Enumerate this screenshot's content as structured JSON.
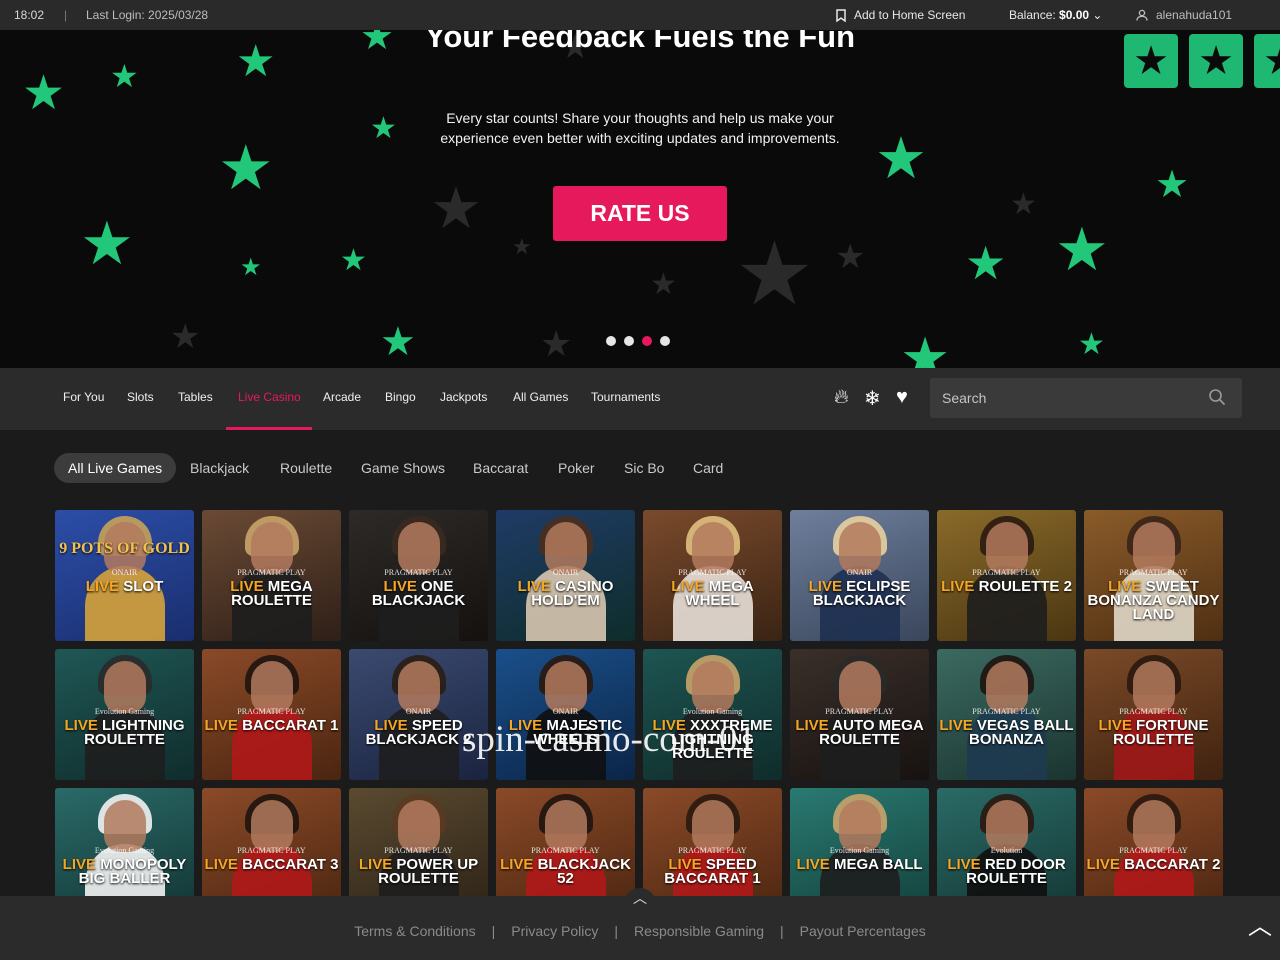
{
  "topbar": {
    "time": "18:02",
    "separator": "|",
    "last_login": "Last Login: 2025/03/28",
    "add_home": "Add to Home Screen",
    "balance_label": "Balance:",
    "balance_value": "$0.00",
    "username": "alenahuda101"
  },
  "hero": {
    "title": "Your Feedback Fuels the Fun",
    "text": "Every star counts! Share your thoughts and help us make your experience even better with exciting updates and improvements.",
    "button": "RATE US",
    "slides": 4,
    "active_slide": 3,
    "accent": "#e5195b",
    "star_color": "#22c77a"
  },
  "nav": {
    "items": [
      "For You",
      "Slots",
      "Tables",
      "Live Casino",
      "Arcade",
      "Bingo",
      "Jackpots",
      "All Games",
      "Tournaments"
    ],
    "active": "Live Casino",
    "icons": [
      "fire-icon",
      "snowflake-icon",
      "heart-icon"
    ],
    "search_placeholder": "Search"
  },
  "filters": {
    "items": [
      "All Live Games",
      "Blackjack",
      "Roulette",
      "Game Shows",
      "Baccarat",
      "Poker",
      "Sic Bo",
      "Card"
    ],
    "active": "All Live Games"
  },
  "games": [
    {
      "live": "LIVE",
      "name": "SLOT",
      "top": "9 POTS OF GOLD",
      "brand": "ONAIR"
    },
    {
      "live": "LIVE",
      "name": "MEGA ROULETTE",
      "brand": "PRAGMATIC PLAY"
    },
    {
      "live": "LIVE",
      "name": "ONE BLACKJACK",
      "brand": "PRAGMATIC PLAY"
    },
    {
      "live": "LIVE",
      "name": "CASINO HOLD'EM",
      "brand": "ONAIR"
    },
    {
      "live": "LIVE",
      "name": "MEGA WHEEL",
      "brand": "PRAGMATIC PLAY"
    },
    {
      "live": "LIVE",
      "name": "ECLIPSE BLACKJACK",
      "brand": "ONAIR"
    },
    {
      "live": "LIVE",
      "name": "ROULETTE 2",
      "brand": "PRAGMATIC PLAY"
    },
    {
      "live": "LIVE",
      "name": "SWEET BONANZA CANDY LAND",
      "brand": "PRAGMATIC PLAY"
    },
    {
      "live": "LIVE",
      "name": "LIGHTNING ROULETTE",
      "brand": "Evolution Gaming"
    },
    {
      "live": "LIVE",
      "name": "BACCARAT 1",
      "brand": "PRAGMATIC PLAY"
    },
    {
      "live": "LIVE",
      "name": "SPEED BLACKJACK 2",
      "brand": "ONAIR"
    },
    {
      "live": "LIVE",
      "name": "MAJESTIC WHEELS",
      "brand": "ONAIR"
    },
    {
      "live": "LIVE",
      "name": "XXXTREME LIGHTNING ROULETTE",
      "brand": "Evolution Gaming"
    },
    {
      "live": "LIVE",
      "name": "AUTO MEGA ROULETTE",
      "brand": "PRAGMATIC PLAY"
    },
    {
      "live": "LIVE",
      "name": "VEGAS BALL BONANZA",
      "brand": "PRAGMATIC PLAY"
    },
    {
      "live": "LIVE",
      "name": "FORTUNE ROULETTE",
      "brand": "PRAGMATIC PLAY"
    },
    {
      "live": "LIVE",
      "name": "MONOPOLY BIG BALLER",
      "brand": "Evolution Gaming"
    },
    {
      "live": "LIVE",
      "name": "BACCARAT 3",
      "brand": "PRAGMATIC PLAY"
    },
    {
      "live": "LIVE",
      "name": "POWER UP ROULETTE",
      "brand": "PRAGMATIC PLAY"
    },
    {
      "live": "LIVE",
      "name": "BLACKJACK 52",
      "brand": "PRAGMATIC PLAY"
    },
    {
      "live": "LIVE",
      "name": "SPEED BACCARAT 1",
      "brand": "PRAGMATIC PLAY"
    },
    {
      "live": "LIVE",
      "name": "MEGA BALL",
      "brand": "Evolution Gaming"
    },
    {
      "live": "LIVE",
      "name": "RED DOOR ROULETTE",
      "brand": "Evolution"
    },
    {
      "live": "LIVE",
      "name": "BACCARAT 2",
      "brand": "PRAGMATIC PLAY"
    }
  ],
  "watermark": "spin-casino-com-01",
  "footer": {
    "links": [
      "Terms & Conditions",
      "Privacy Policy",
      "Responsible Gaming",
      "Payout Percentages"
    ],
    "separator": "|"
  }
}
